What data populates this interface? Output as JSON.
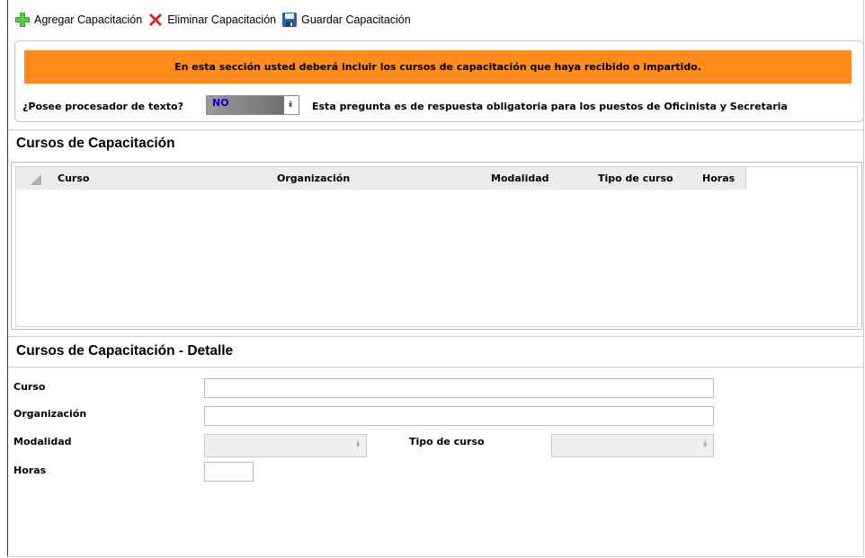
{
  "toolbar": {
    "add_label": "Agregar Capacitación",
    "delete_label": "Eliminar Capacitación",
    "save_label": "Guardar Capacitación"
  },
  "banner": {
    "text": "En esta sección usted deberá incluir los cursos de capacitación que haya recibido o impartido.",
    "color": "#ff8c1a"
  },
  "question": {
    "label": "¿Posee procesador de texto?",
    "value": "NO",
    "note": "Esta pregunta es de respuesta obligatoria para los puestos de Oficinista y Secretaria"
  },
  "grid": {
    "title": "Cursos de Capacitación",
    "columns": [
      "Curso",
      "Organización",
      "Modalidad",
      "Tipo de curso",
      "Horas"
    ],
    "rows": []
  },
  "detail": {
    "title": "Cursos de Capacitación - Detalle",
    "curso_label": "Curso",
    "curso_value": "",
    "organizacion_label": "Organización",
    "organizacion_value": "",
    "modalidad_label": "Modalidad",
    "modalidad_value": "",
    "tipo_label": "Tipo de curso",
    "tipo_value": "",
    "horas_label": "Horas",
    "horas_value": ""
  },
  "icons": {
    "add": "plus-icon",
    "delete": "x-icon",
    "save": "floppy-disk-icon",
    "dropdown": "double-chevron-down-icon"
  }
}
